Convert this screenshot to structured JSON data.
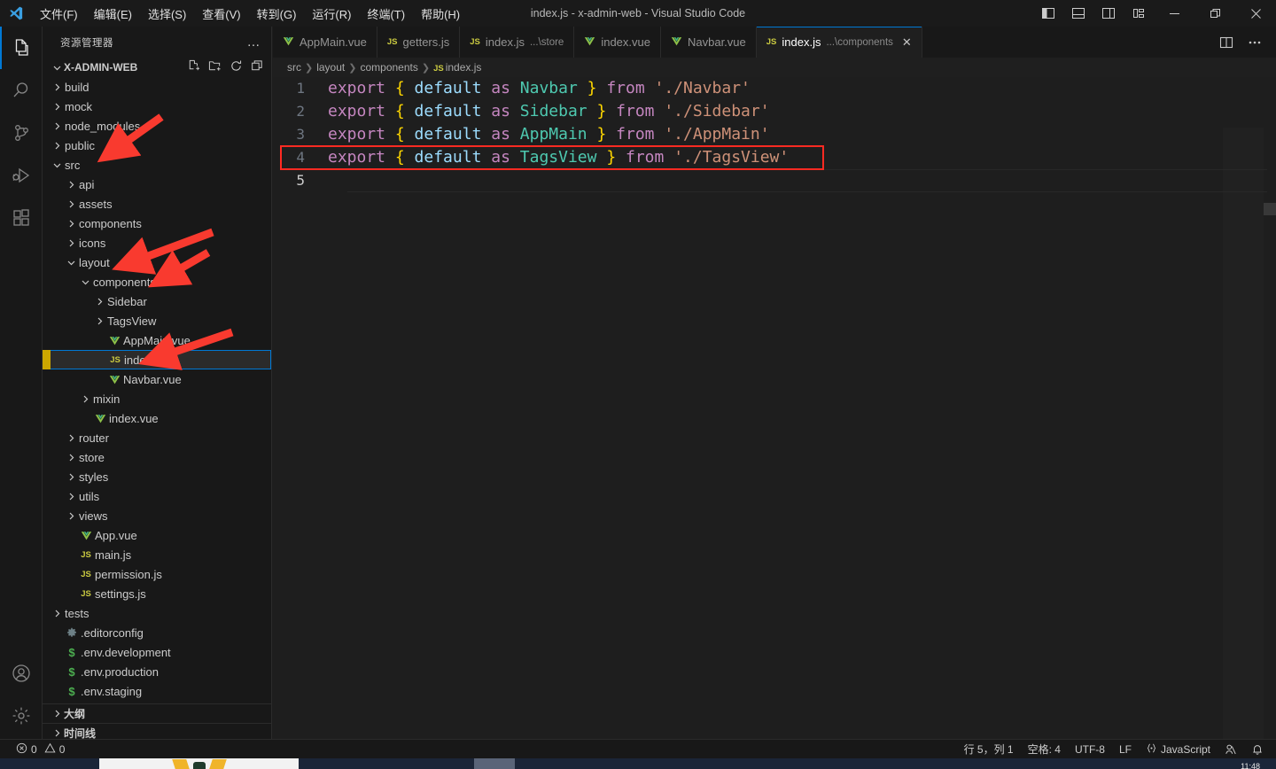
{
  "window": {
    "title": "index.js - x-admin-web - Visual Studio Code",
    "logo_icon": "vscode-logo-icon",
    "menus": [
      {
        "label": "文件(F)",
        "name": "menu-file"
      },
      {
        "label": "编辑(E)",
        "name": "menu-edit"
      },
      {
        "label": "选择(S)",
        "name": "menu-selection"
      },
      {
        "label": "查看(V)",
        "name": "menu-view"
      },
      {
        "label": "转到(G)",
        "name": "menu-go"
      },
      {
        "label": "运行(R)",
        "name": "menu-run"
      },
      {
        "label": "终端(T)",
        "name": "menu-terminal"
      },
      {
        "label": "帮助(H)",
        "name": "menu-help"
      }
    ],
    "layout_buttons": [
      {
        "name": "toggle-primary-sidebar-icon"
      },
      {
        "name": "toggle-panel-icon"
      },
      {
        "name": "toggle-secondary-sidebar-icon"
      },
      {
        "name": "customize-layout-icon"
      }
    ],
    "controls": [
      {
        "name": "window-minimize-icon"
      },
      {
        "name": "window-restore-icon"
      },
      {
        "name": "window-close-icon"
      }
    ]
  },
  "activitybar": {
    "items": [
      {
        "name": "activity-explorer",
        "icon": "files-icon",
        "active": true
      },
      {
        "name": "activity-search",
        "icon": "search-icon",
        "active": false
      },
      {
        "name": "activity-source-control",
        "icon": "source-control-icon",
        "active": false
      },
      {
        "name": "activity-run-debug",
        "icon": "run-and-debug-icon",
        "active": false
      },
      {
        "name": "activity-extensions",
        "icon": "extensions-icon",
        "active": false
      }
    ],
    "bottom": [
      {
        "name": "activity-accounts",
        "icon": "account-icon"
      },
      {
        "name": "activity-settings",
        "icon": "gear-icon"
      }
    ]
  },
  "sidebar": {
    "title": "资源管理器",
    "more_actions": "…",
    "project": {
      "name": "X-ADMIN-WEB",
      "actions": [
        {
          "name": "new-file-icon"
        },
        {
          "name": "new-folder-icon"
        },
        {
          "name": "refresh-explorer-icon"
        },
        {
          "name": "collapse-folders-icon"
        }
      ]
    },
    "tree": [
      {
        "label": "build",
        "indent": 1,
        "type": "folder",
        "state": "collapsed"
      },
      {
        "label": "mock",
        "indent": 1,
        "type": "folder",
        "state": "collapsed"
      },
      {
        "label": "node_modules",
        "indent": 1,
        "type": "folder",
        "state": "collapsed"
      },
      {
        "label": "public",
        "indent": 1,
        "type": "folder",
        "state": "collapsed"
      },
      {
        "label": "src",
        "indent": 1,
        "type": "folder",
        "state": "expanded"
      },
      {
        "label": "api",
        "indent": 2,
        "type": "folder",
        "state": "collapsed"
      },
      {
        "label": "assets",
        "indent": 2,
        "type": "folder",
        "state": "collapsed"
      },
      {
        "label": "components",
        "indent": 2,
        "type": "folder",
        "state": "collapsed"
      },
      {
        "label": "icons",
        "indent": 2,
        "type": "folder",
        "state": "collapsed"
      },
      {
        "label": "layout",
        "indent": 2,
        "type": "folder",
        "state": "expanded"
      },
      {
        "label": "components",
        "indent": 3,
        "type": "folder",
        "state": "expanded"
      },
      {
        "label": "Sidebar",
        "indent": 4,
        "type": "folder",
        "state": "collapsed"
      },
      {
        "label": "TagsView",
        "indent": 4,
        "type": "folder",
        "state": "collapsed"
      },
      {
        "label": "AppMain.vue",
        "indent": 4,
        "type": "vue"
      },
      {
        "label": "index.js",
        "indent": 4,
        "type": "js",
        "selected": true
      },
      {
        "label": "Navbar.vue",
        "indent": 4,
        "type": "vue"
      },
      {
        "label": "mixin",
        "indent": 3,
        "type": "folder",
        "state": "collapsed"
      },
      {
        "label": "index.vue",
        "indent": 3,
        "type": "vue"
      },
      {
        "label": "router",
        "indent": 2,
        "type": "folder",
        "state": "collapsed"
      },
      {
        "label": "store",
        "indent": 2,
        "type": "folder",
        "state": "collapsed"
      },
      {
        "label": "styles",
        "indent": 2,
        "type": "folder",
        "state": "collapsed"
      },
      {
        "label": "utils",
        "indent": 2,
        "type": "folder",
        "state": "collapsed"
      },
      {
        "label": "views",
        "indent": 2,
        "type": "folder",
        "state": "collapsed"
      },
      {
        "label": "App.vue",
        "indent": 2,
        "type": "vue"
      },
      {
        "label": "main.js",
        "indent": 2,
        "type": "js"
      },
      {
        "label": "permission.js",
        "indent": 2,
        "type": "js"
      },
      {
        "label": "settings.js",
        "indent": 2,
        "type": "js"
      },
      {
        "label": "tests",
        "indent": 1,
        "type": "folder",
        "state": "collapsed"
      },
      {
        "label": ".editorconfig",
        "indent": 1,
        "type": "cfg"
      },
      {
        "label": ".env.development",
        "indent": 1,
        "type": "env"
      },
      {
        "label": ".env.production",
        "indent": 1,
        "type": "env"
      },
      {
        "label": ".env.staging",
        "indent": 1,
        "type": "env"
      }
    ],
    "sections": [
      {
        "label": "大纲",
        "name": "outline-section"
      },
      {
        "label": "时间线",
        "name": "timeline-section"
      }
    ]
  },
  "editor": {
    "tabs": [
      {
        "label": "AppMain.vue",
        "suffix": "",
        "icon": "vue",
        "active": false
      },
      {
        "label": "getters.js",
        "suffix": "",
        "icon": "js",
        "active": false
      },
      {
        "label": "index.js",
        "suffix": "...\\store",
        "icon": "js",
        "active": false
      },
      {
        "label": "index.vue",
        "suffix": "",
        "icon": "vue",
        "active": false
      },
      {
        "label": "Navbar.vue",
        "suffix": "",
        "icon": "vue",
        "active": false
      },
      {
        "label": "index.js",
        "suffix": "...\\components",
        "icon": "js",
        "active": true,
        "close": "✕"
      }
    ],
    "tab_actions": [
      {
        "name": "split-editor-right-icon"
      },
      {
        "name": "editor-more-actions-icon"
      }
    ],
    "breadcrumb": [
      "src",
      "layout",
      "components",
      "index.js"
    ],
    "highlight_color": "#ff2a22",
    "highlighted_line": 4,
    "lines": [
      {
        "no": 1,
        "tokens": [
          {
            "t": "export ",
            "c": "kw"
          },
          {
            "t": "{ ",
            "c": "br"
          },
          {
            "t": "default ",
            "c": "id"
          },
          {
            "t": "as ",
            "c": "kw"
          },
          {
            "t": "Navbar ",
            "c": "cls"
          },
          {
            "t": "} ",
            "c": "br"
          },
          {
            "t": "from ",
            "c": "kw"
          },
          {
            "t": "'./Navbar'",
            "c": "str"
          }
        ]
      },
      {
        "no": 2,
        "tokens": [
          {
            "t": "export ",
            "c": "kw"
          },
          {
            "t": "{ ",
            "c": "br"
          },
          {
            "t": "default ",
            "c": "id"
          },
          {
            "t": "as ",
            "c": "kw"
          },
          {
            "t": "Sidebar ",
            "c": "cls"
          },
          {
            "t": "} ",
            "c": "br"
          },
          {
            "t": "from ",
            "c": "kw"
          },
          {
            "t": "'./Sidebar'",
            "c": "str"
          }
        ]
      },
      {
        "no": 3,
        "tokens": [
          {
            "t": "export ",
            "c": "kw"
          },
          {
            "t": "{ ",
            "c": "br"
          },
          {
            "t": "default ",
            "c": "id"
          },
          {
            "t": "as ",
            "c": "kw"
          },
          {
            "t": "AppMain ",
            "c": "cls"
          },
          {
            "t": "} ",
            "c": "br"
          },
          {
            "t": "from ",
            "c": "kw"
          },
          {
            "t": "'./AppMain'",
            "c": "str"
          }
        ]
      },
      {
        "no": 4,
        "tokens": [
          {
            "t": "export ",
            "c": "kw"
          },
          {
            "t": "{ ",
            "c": "br"
          },
          {
            "t": "default ",
            "c": "id"
          },
          {
            "t": "as ",
            "c": "kw"
          },
          {
            "t": "TagsView ",
            "c": "cls"
          },
          {
            "t": "} ",
            "c": "br"
          },
          {
            "t": "from ",
            "c": "kw"
          },
          {
            "t": "'./TagsView'",
            "c": "str"
          }
        ]
      },
      {
        "no": 5,
        "tokens": [],
        "current": true
      }
    ]
  },
  "statusbar": {
    "errors": "0",
    "warnings": "0",
    "position": "行 5，列 1",
    "indentation": "空格: 4",
    "encoding": "UTF-8",
    "eol": "LF",
    "language": "JavaScript",
    "feedback_icon": "feedback-icon",
    "bell_icon": "notifications-bell-icon"
  },
  "taskbar": {
    "clock": "11:48"
  }
}
